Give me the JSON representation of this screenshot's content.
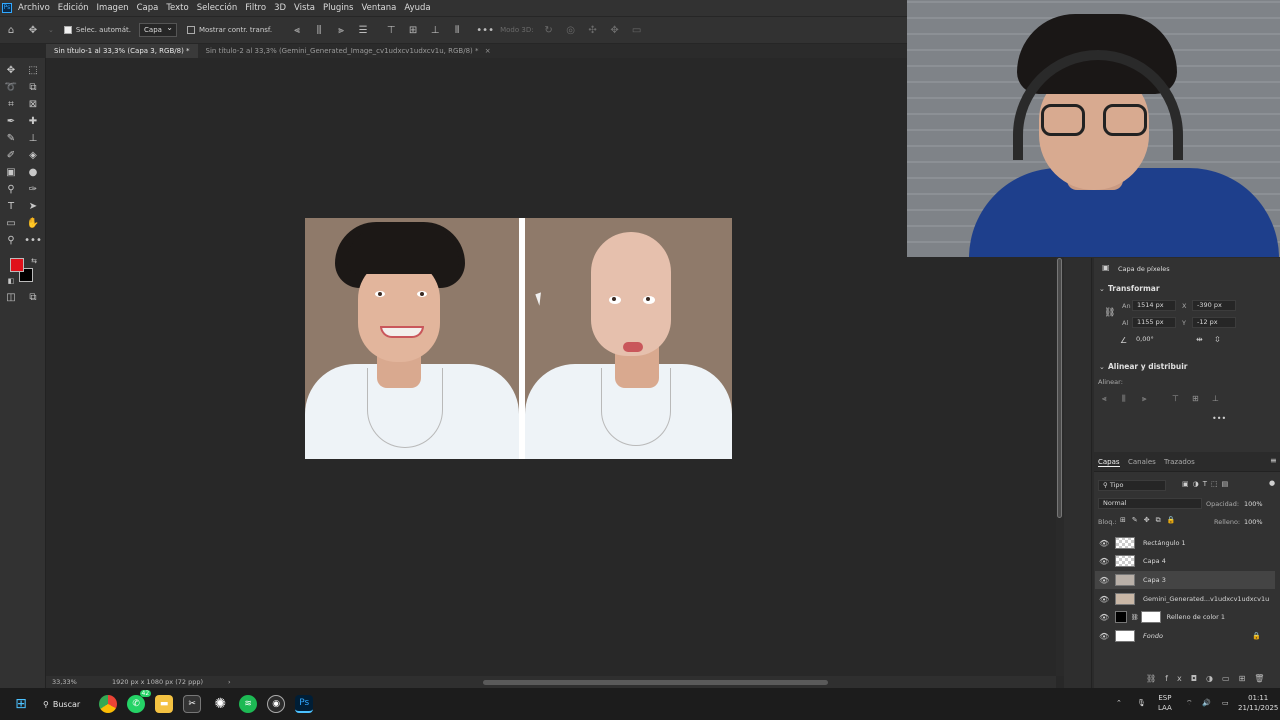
{
  "menu": {
    "logo": "Ps",
    "items": [
      "Archivo",
      "Edición",
      "Imagen",
      "Capa",
      "Texto",
      "Selección",
      "Filtro",
      "3D",
      "Vista",
      "Plugins",
      "Ventana",
      "Ayuda"
    ]
  },
  "options_bar": {
    "auto_select_label": "Selec. automát.",
    "auto_select_target": "Capa",
    "show_transform_label": "Mostrar contr. transf.",
    "mode_3d_label": "Modo 3D:"
  },
  "tabs": [
    {
      "label": "Sin título-1 al 33,3% (Capa 3, RGB/8) *",
      "active": true
    },
    {
      "label": "Sin título-2 al 33,3% (Gemini_Generated_Image_cv1udxcv1udxcv1u, RGB/8) *",
      "active": false
    }
  ],
  "colors": {
    "foreground": "#e0101a",
    "background": "#000000",
    "accent": "#31a8ff"
  },
  "status": {
    "zoom": "33,33%",
    "doc_info": "1920 px x 1080 px (72 ppp)"
  },
  "properties": {
    "kind": "Capa de píxeles",
    "transform_title": "Transformar",
    "width_label": "An",
    "width": "1514 px",
    "height_label": "Al",
    "height": "1155 px",
    "x_label": "X",
    "x": "-390 px",
    "y_label": "Y",
    "y": "-12 px",
    "angle": "0,00°",
    "align_title": "Alinear y distribuir",
    "align_label": "Alinear:"
  },
  "layers_panel": {
    "tabs": [
      "Capas",
      "Canales",
      "Trazados"
    ],
    "filter": "Tipo",
    "blend_mode": "Normal",
    "opacity_label": "Opacidad:",
    "opacity": "100%",
    "lock_label": "Bloq.:",
    "fill_label": "Relleno:",
    "fill": "100%",
    "layers": [
      {
        "name": "Rectángulo 1",
        "selected": false
      },
      {
        "name": "Capa 4",
        "selected": false
      },
      {
        "name": "Capa 3",
        "selected": true
      },
      {
        "name": "Gemini_Generated...v1udxcv1udxcv1u",
        "selected": false
      },
      {
        "name": "Relleno de color 1",
        "selected": false
      },
      {
        "name": "Fondo",
        "selected": false
      }
    ]
  },
  "taskbar": {
    "search_label": "Buscar",
    "badge": "42",
    "lang": "ESP",
    "lang_sub": "LAA",
    "time": "01:11",
    "date": "21/11/2025"
  }
}
